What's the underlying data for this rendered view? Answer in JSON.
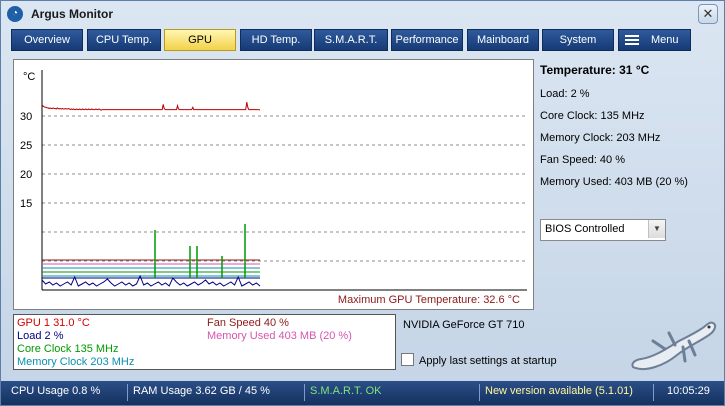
{
  "window": {
    "title": "Argus Monitor",
    "close_glyph": "✕",
    "app_icon": "argus-logo-icon"
  },
  "tabs": [
    {
      "label": "Overview"
    },
    {
      "label": "CPU Temp."
    },
    {
      "label": "GPU"
    },
    {
      "label": "HD Temp."
    },
    {
      "label": "S.M.A.R.T."
    },
    {
      "label": "Performance"
    },
    {
      "label": "Mainboard"
    },
    {
      "label": "System"
    },
    {
      "label": "Menu"
    }
  ],
  "active_tab": "GPU",
  "chart": {
    "unit": "°C",
    "y_ticks": [
      "30",
      "25",
      "20",
      "15"
    ],
    "footer": "Maximum GPU Temperature: 32.6 °C"
  },
  "chart_data": {
    "type": "line",
    "ylabel": "°C",
    "yticks": [
      15,
      20,
      25,
      30
    ],
    "grid": true,
    "series": [
      {
        "name": "GPU 1",
        "color": "#c00000",
        "values": [
          32.0,
          31.7,
          31.6,
          31.5,
          31.5,
          31.4,
          31.4,
          31.3,
          31.4,
          31.3,
          31.3,
          31.4,
          31.3,
          31.3,
          31.2,
          31.4,
          31.3,
          31.2,
          31.3,
          31.2,
          31.3,
          31.2,
          31.2,
          31.3,
          31.2,
          31.2,
          31.3,
          31.2,
          31.1,
          31.2,
          31.1,
          31.2,
          31.1,
          31.1,
          31.2,
          31.1,
          31.1,
          31.2,
          31.1,
          31.1,
          31.2,
          31.1,
          31.1,
          31.2,
          31.1,
          31.1,
          31.2,
          31.1,
          31.1,
          31.2,
          31.1,
          31.1,
          31.1,
          31.2,
          31.1,
          31.1,
          31.2,
          31.1,
          31.0,
          31.1,
          31.1,
          31.1,
          31.1,
          31.1,
          31.1,
          31.1,
          31.1,
          31.1,
          31.1,
          31.1,
          31.1,
          31.1,
          31.1,
          31.1,
          31.1,
          31.1,
          31.1,
          31.1,
          31.1,
          31.1,
          31.1,
          31.1,
          31.1,
          31.1,
          31.1,
          31.1,
          31.1,
          31.1,
          31.1,
          31.1,
          31.1,
          31.1,
          31.1,
          31.1,
          31.1,
          31.1,
          31.1,
          31.1,
          31.1,
          31.1,
          31.1,
          31.1,
          31.1,
          31.1,
          31.1,
          31.1,
          31.1,
          31.1,
          31.1,
          31.1,
          31.1,
          31.1,
          31.1,
          31.1,
          31.1,
          31.1,
          31.1,
          31.1,
          31.1,
          32.0,
          31.3,
          31.1,
          31.1,
          31.1,
          31.1,
          31.1,
          31.1,
          31.1,
          31.1,
          31.1,
          31.1,
          31.1,
          31.1,
          31.8,
          31.2,
          31.1,
          31.1,
          31.1,
          31.1,
          31.1,
          31.1,
          31.1,
          31.1,
          31.1,
          31.1,
          31.1,
          31.1,
          31.1,
          31.5,
          31.1,
          31.1,
          31.1,
          31.1,
          31.1,
          31.1,
          31.1,
          31.1,
          31.1,
          31.1,
          31.1,
          31.1,
          31.1,
          31.1,
          31.1,
          31.1,
          31.1,
          31.1,
          31.1,
          31.1,
          31.1,
          31.1,
          31.1,
          31.1,
          31.1,
          31.1,
          31.1,
          31.1,
          31.1,
          31.1,
          31.1,
          31.1,
          31.1,
          31.1,
          31.1,
          31.1,
          31.1,
          31.1,
          31.1,
          31.1,
          31.1,
          31.1,
          31.1,
          31.1,
          31.1,
          31.1,
          31.1,
          31.1,
          31.1,
          31.1,
          31.1,
          31.1,
          32.4,
          31.5,
          31.1,
          31.1,
          31.1,
          31.1,
          31.1,
          31.1,
          31.1,
          31.1,
          31.1,
          31.1,
          31.1,
          31.0
        ]
      }
    ]
  },
  "gpu_info": {
    "temperature": "Temperature: 31 °C",
    "load": "Load: 2 %",
    "core_clock": "Core Clock: 135 MHz",
    "memory_clock": "Memory Clock: 203 MHz",
    "fan_speed": "Fan Speed: 40 %",
    "memory_used": "Memory Used: 403 MB (20 %)"
  },
  "bios_select": {
    "value": "BIOS Controlled"
  },
  "legend": {
    "gpu": {
      "text": "GPU 1 31.0 °C",
      "color": "#d40000"
    },
    "load": {
      "text": "Load 2 %",
      "color": "#000080"
    },
    "core_clock": {
      "text": "Core Clock 135 MHz",
      "color": "#009a00"
    },
    "memory_clock": {
      "text": "Memory Clock 203 MHz",
      "color": "#0a8fb0"
    },
    "fan_speed": {
      "text": "Fan Speed 40 %",
      "color": "#8b1a1a"
    },
    "memory_used": {
      "text": "Memory Used 403 MB  (20 %)",
      "color": "#d455b0"
    }
  },
  "card_name": "NVIDIA GeForce GT 710",
  "apply_label": "Apply last settings at startup",
  "status": {
    "cpu_usage": "CPU Usage 0.8 %",
    "ram_usage": "RAM Usage 3.62 GB / 45 %",
    "smart": "S.M.A.R.T. OK",
    "update": "New version available  (5.1.01)",
    "time": "10:05:29",
    "smart_color": "#7de37d"
  }
}
